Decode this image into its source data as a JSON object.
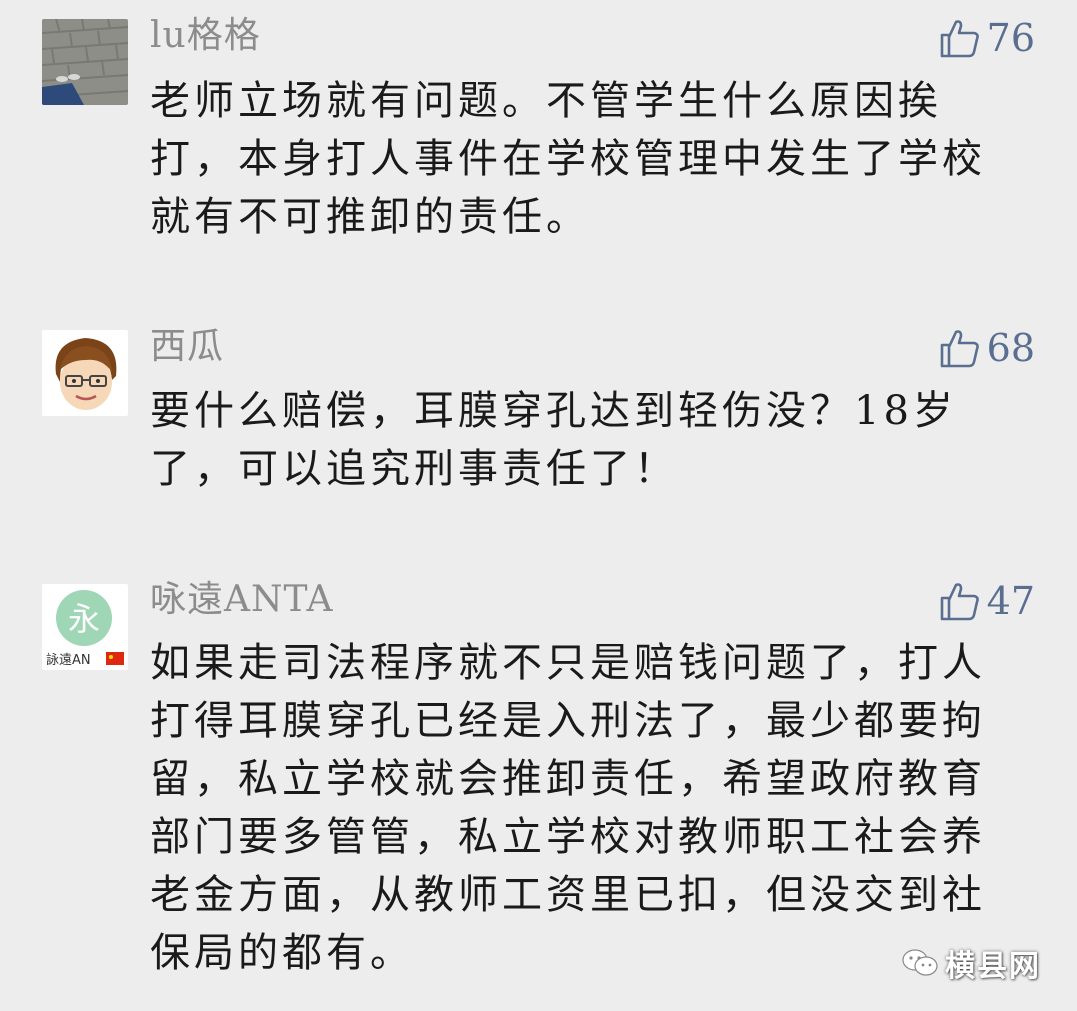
{
  "colors": {
    "background": "#ededed",
    "username": "#8c8c8c",
    "likes": "#5a6f90",
    "text": "#1a1a1a"
  },
  "comments": [
    {
      "username": "lu格格",
      "likes": "76",
      "avatar_icon": "brick-pavement-photo-icon",
      "text": "老师立场就有问题。不管学生什么原因挨打，本身打人事件在学校管理中发生了学校就有不可推卸的责任。"
    },
    {
      "username": "西瓜",
      "likes": "68",
      "avatar_icon": "cartoon-face-icon",
      "text": "要什么赔偿，耳膜穿孔达到轻伤没？18岁了，可以追究刑事责任了！"
    },
    {
      "username": "咏遠ANTA",
      "likes": "47",
      "avatar_icon": "yong-character-avatar-icon",
      "avatar_caption": "詠遠AN",
      "avatar_char": "永",
      "text": "如果走司法程序就不只是赔钱问题了，打人打得耳膜穿孔已经是入刑法了，最少都要拘留，私立学校就会推卸责任，希望政府教育部门要多管管，私立学校对教师职工社会养老金方面，从教师工资里已扣，但没交到社保局的都有。"
    }
  ],
  "watermark": {
    "label": "横县网",
    "icon": "wechat-icon"
  }
}
